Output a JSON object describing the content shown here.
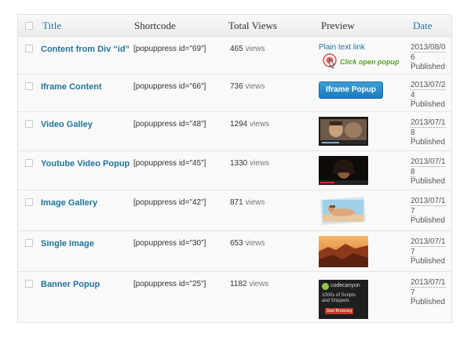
{
  "columns": {
    "title": "Title",
    "shortcode": "Shortcode",
    "views": "Total Views",
    "preview": "Preview",
    "date": "Date"
  },
  "views_unit": "views",
  "rows": [
    {
      "title": "Content from Div “id”",
      "shortcode": "[popuppress id=\"69\"]",
      "views": "465",
      "date1": "2013/08/0",
      "date2": "6",
      "status": "Published",
      "preview_link": "Plain text link",
      "preview_hint": "Click open popup"
    },
    {
      "title": "Iframe Content",
      "shortcode": "[popuppress id=\"66\"]",
      "views": "736",
      "date1": "2013/07/2",
      "date2": "4",
      "status": "Published",
      "preview_button": "Iframe Popup"
    },
    {
      "title": "Video Galley",
      "shortcode": "[popuppress id=\"48\"]",
      "views": "1294",
      "date1": "2013/07/1",
      "date2": "8",
      "status": "Published"
    },
    {
      "title": "Youtube Video Popup",
      "shortcode": "[popuppress id=\"45\"]",
      "views": "1330",
      "date1": "2013/07/1",
      "date2": "8",
      "status": "Published"
    },
    {
      "title": "Image Gallery",
      "shortcode": "[popuppress id=\"42\"]",
      "views": "871",
      "date1": "2013/07/1",
      "date2": "7",
      "status": "Published"
    },
    {
      "title": "Single Image",
      "shortcode": "[popuppress id=\"30\"]",
      "views": "653",
      "date1": "2013/07/1",
      "date2": "7",
      "status": "Published"
    },
    {
      "title": "Banner Popup",
      "shortcode": "[popuppress id=\"25\"]",
      "views": "1182",
      "date1": "2013/07/1",
      "date2": "7",
      "status": "Published",
      "banner_brand": "codecanyon",
      "banner_line1": "1000s of Scripts",
      "banner_line2": "and Snippets",
      "banner_button": "Start Browsing"
    }
  ],
  "colors": {
    "link": "#21759b",
    "button": "#2a8cce",
    "hint": "#5aa02c",
    "banner_button": "#c0392b"
  }
}
